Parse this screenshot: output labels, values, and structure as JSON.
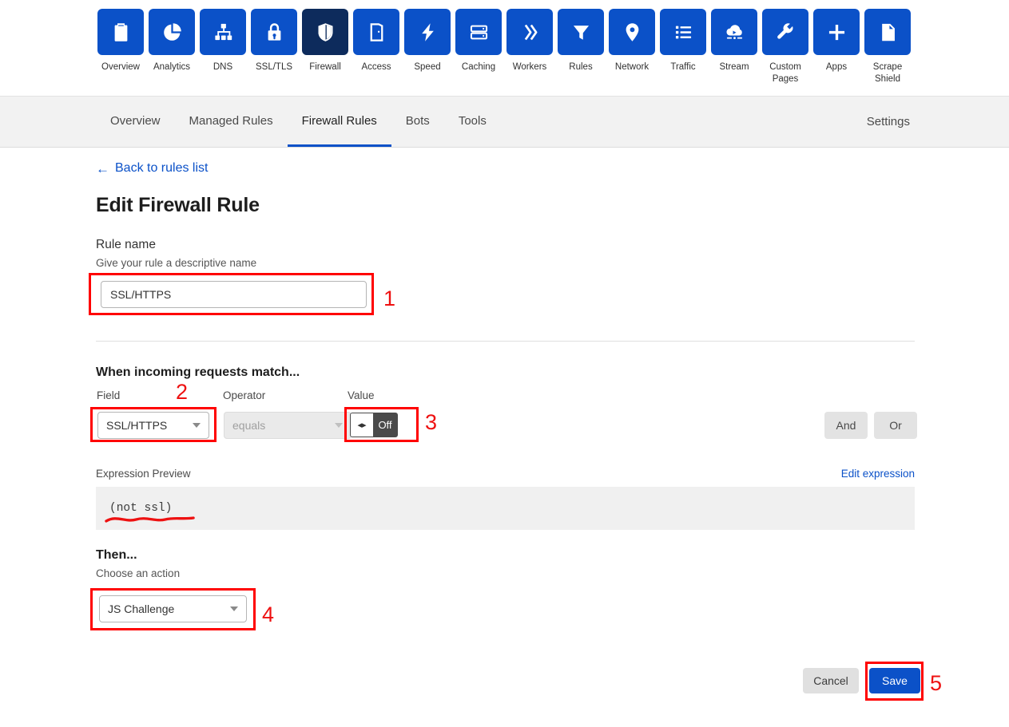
{
  "app_nav": {
    "items": [
      {
        "label": "Overview",
        "icon": "clipboard-icon",
        "active": false
      },
      {
        "label": "Analytics",
        "icon": "pie-chart-icon",
        "active": false
      },
      {
        "label": "DNS",
        "icon": "sitemap-icon",
        "active": false
      },
      {
        "label": "SSL/TLS",
        "icon": "lock-icon",
        "active": false
      },
      {
        "label": "Firewall",
        "icon": "shield-icon",
        "active": true
      },
      {
        "label": "Access",
        "icon": "door-icon",
        "active": false
      },
      {
        "label": "Speed",
        "icon": "lightning-bolt-icon",
        "active": false
      },
      {
        "label": "Caching",
        "icon": "server-stack-icon",
        "active": false
      },
      {
        "label": "Workers",
        "icon": "chevrons-right-icon",
        "active": false
      },
      {
        "label": "Rules",
        "icon": "funnel-icon",
        "active": false
      },
      {
        "label": "Network",
        "icon": "map-pin-icon",
        "active": false
      },
      {
        "label": "Traffic",
        "icon": "list-icon",
        "active": false
      },
      {
        "label": "Stream",
        "icon": "cloud-play-icon",
        "active": false
      },
      {
        "label": "Custom\nPages",
        "icon": "wrench-icon",
        "active": false
      },
      {
        "label": "Apps",
        "icon": "plus-icon",
        "active": false
      },
      {
        "label": "Scrape\nShield",
        "icon": "document-icon",
        "active": false
      }
    ]
  },
  "subnav": {
    "tabs": [
      {
        "label": "Overview",
        "active": false
      },
      {
        "label": "Managed Rules",
        "active": false
      },
      {
        "label": "Firewall Rules",
        "active": true
      },
      {
        "label": "Bots",
        "active": false
      },
      {
        "label": "Tools",
        "active": false
      }
    ],
    "settings_label": "Settings"
  },
  "main": {
    "back_link": "Back to rules list",
    "back_arrow": "←",
    "page_title": "Edit Firewall Rule",
    "rule_name": {
      "section_label": "Rule name",
      "hint": "Give your rule a descriptive name",
      "value": "SSL/HTTPS",
      "placeholder": "Give your rule a descriptive name"
    },
    "match_heading": "When incoming requests match...",
    "condition": {
      "field_label": "Field",
      "field_value": "SSL/HTTPS",
      "operator_label": "Operator",
      "operator_value": "equals",
      "value_label": "Value",
      "toggle_state": "Off",
      "toggle_knob_glyph": "◂▸"
    },
    "logic": {
      "and_label": "And",
      "or_label": "Or"
    },
    "expression": {
      "label": "Expression Preview",
      "edit_label": "Edit expression",
      "text": "(not ssl)"
    },
    "then": {
      "heading": "Then...",
      "hint": "Choose an action",
      "action_value": "JS Challenge"
    },
    "footer": {
      "cancel_label": "Cancel",
      "save_label": "Save"
    }
  },
  "annotations": {
    "numbers": [
      "1",
      "2",
      "3",
      "4",
      "5"
    ],
    "color": "#ff0000"
  },
  "colors": {
    "brand_blue": "#0b51c8",
    "active_navy": "#0d2b5c",
    "annotation_red": "#ff0000",
    "toggle_dark": "#4a4a4a"
  }
}
